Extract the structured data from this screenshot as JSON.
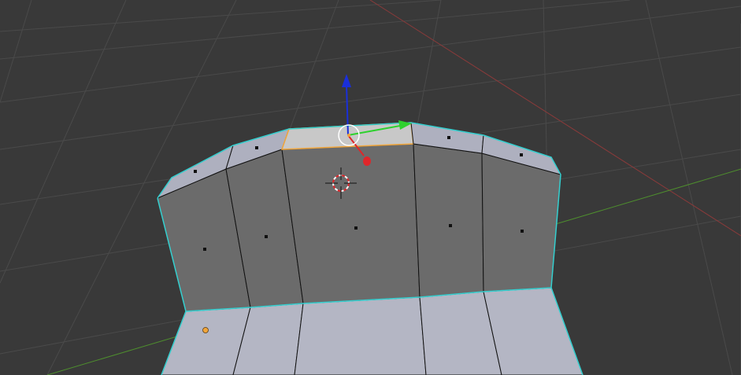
{
  "viewport": {
    "background": "#393939",
    "grid_color": "#4a4a4a",
    "x_axis_color": "#8a3a3a",
    "y_axis_color": "#4e8e2e"
  },
  "mesh": {
    "face_color_side": "#6b6b6b",
    "face_color_top": "#aeb0bf",
    "face_color_bottom": "#b4b6c4",
    "edge_color": "#111111",
    "outline_color": "#35d0d0",
    "selected_face_color": "#c8c8c8",
    "selected_edge_color": "#f0a53a",
    "face_dot_color": "#111111"
  },
  "gizmo": {
    "x_color": "#e0262a",
    "y_color": "#2ed12e",
    "z_color": "#1a2fd9",
    "ring_color": "#ffffff",
    "center_color": "#f0a53a"
  },
  "cursor_3d": {
    "ring_colors": [
      "#e0262a",
      "#ffffff"
    ],
    "cross_color": "#111111"
  }
}
